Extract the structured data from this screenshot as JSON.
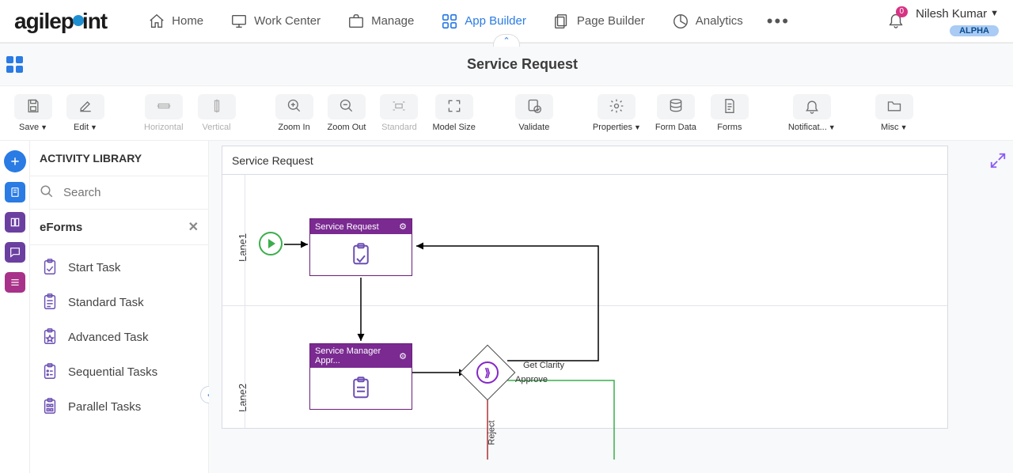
{
  "brand": {
    "name": "agilepoint"
  },
  "nav": {
    "items": [
      {
        "label": "Home",
        "icon": "home",
        "active": false
      },
      {
        "label": "Work Center",
        "icon": "monitor",
        "active": false
      },
      {
        "label": "Manage",
        "icon": "briefcase",
        "active": false
      },
      {
        "label": "App Builder",
        "icon": "grid",
        "active": true
      },
      {
        "label": "Page Builder",
        "icon": "pages",
        "active": false
      },
      {
        "label": "Analytics",
        "icon": "pie",
        "active": false
      }
    ]
  },
  "user": {
    "name": "Nilesh Kumar",
    "notification_count": "0",
    "badge": "ALPHA"
  },
  "subheader": {
    "title": "Service Request"
  },
  "toolbar": {
    "save": "Save",
    "edit": "Edit",
    "horizontal": "Horizontal",
    "vertical": "Vertical",
    "zoom_in": "Zoom In",
    "zoom_out": "Zoom Out",
    "standard": "Standard",
    "model_size": "Model Size",
    "validate": "Validate",
    "properties": "Properties",
    "form_data": "Form Data",
    "forms": "Forms",
    "notification": "Notificat...",
    "misc": "Misc"
  },
  "sidebar": {
    "title": "ACTIVITY LIBRARY",
    "search_placeholder": "Search",
    "section": "eForms",
    "items": [
      {
        "label": "Start Task"
      },
      {
        "label": "Standard Task"
      },
      {
        "label": "Advanced Task"
      },
      {
        "label": "Sequential Tasks"
      },
      {
        "label": "Parallel Tasks"
      }
    ]
  },
  "canvas": {
    "title": "Service Request",
    "lanes": [
      "Lane1",
      "Lane2"
    ],
    "activities": [
      {
        "label": "Service Request"
      },
      {
        "label": "Service Manager Appr..."
      }
    ],
    "edge_labels": {
      "get_clarity": "Get Clarity",
      "approve": "Approve",
      "reject": "Reject"
    }
  }
}
